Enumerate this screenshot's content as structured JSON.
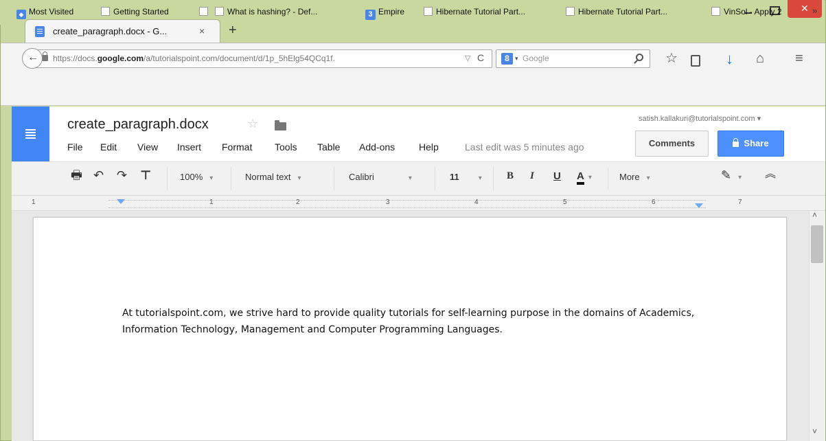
{
  "browser": {
    "tab": {
      "title": "create_paragraph.docx - G...",
      "close": "×"
    },
    "new_tab": "+",
    "url": {
      "prefix": "https://docs.",
      "domain": "google.com",
      "rest": "/a/tutorialspoint.com/document/d/1p_5hElg54QCq1f.",
      "dropdown": "▽"
    },
    "reload": "C",
    "search": {
      "engine": "8",
      "dropdown": "▾",
      "placeholder": "Google"
    },
    "icons": {
      "star": "☆",
      "home": "⌂",
      "menu": "≡",
      "download": "↓"
    }
  },
  "bookmarks": [
    {
      "label": "Most Visited",
      "icon": "most-visited"
    },
    {
      "label": "Getting Started",
      "icon": "box"
    },
    {
      "label": "",
      "icon": "box"
    },
    {
      "label": "What is hashing? - Def...",
      "icon": "box"
    },
    {
      "label": "Empire",
      "icon": "blue"
    },
    {
      "label": "Hibernate Tutorial Part...",
      "icon": "box"
    },
    {
      "label": "Hibernate Tutorial Part...",
      "icon": "box"
    },
    {
      "label": "VinSol - Apply 2",
      "icon": "box"
    }
  ],
  "bookmarks_more": "»",
  "docs": {
    "title": "create_paragraph.docx",
    "star": "☆",
    "menu": [
      "File",
      "Edit",
      "View",
      "Insert",
      "Format",
      "Tools",
      "Table",
      "Add-ons",
      "Help"
    ],
    "last_edit": "Last edit was 5 minutes ago",
    "account": "satish.kallakuri@tutorialspoint.com ▾",
    "comments_label": "Comments",
    "share_label": "Share"
  },
  "toolbar": {
    "print": "🖶",
    "undo": "↶",
    "redo": "↷",
    "zoom": "100%",
    "style": "Normal text",
    "font": "Calibri",
    "size": "11",
    "bold": "B",
    "italic": "I",
    "underline": "U",
    "text_color": "A",
    "more": "More",
    "pen": "✎",
    "collapse": "︽"
  },
  "ruler": {
    "numbers": [
      "1",
      "1",
      "2",
      "3",
      "4",
      "5",
      "6",
      "7"
    ]
  },
  "document": {
    "paragraph": "At tutorialspoint.com, we strive hard to provide quality tutorials for self-learning purpose in the domains of Academics, Information Technology, Management and Computer Programming Languages."
  },
  "scroll": {
    "up": "˄",
    "down": "˅"
  },
  "colors": {
    "frame": "#c9d89f",
    "docs_blue": "#4285f4",
    "share_blue": "#4d90fe",
    "close_red": "#d8483c"
  }
}
